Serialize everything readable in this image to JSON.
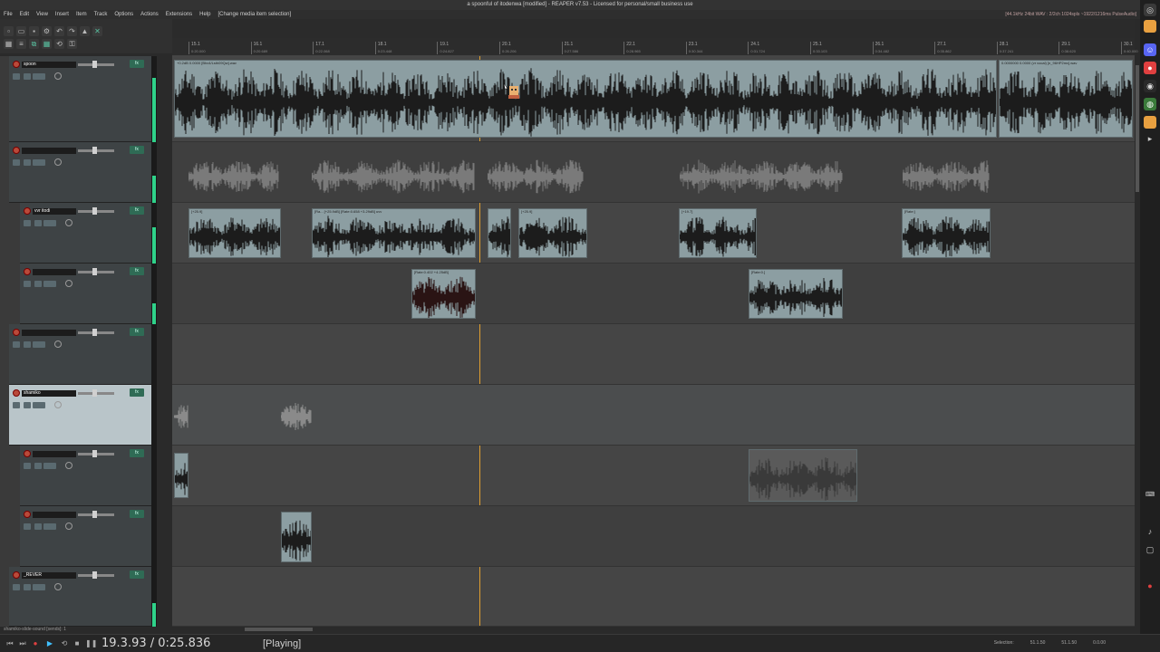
{
  "window": {
    "title": "a spoonful of itodenwa [modified] - REAPER v7.53 - Licensed for personal/small business use"
  },
  "menubar": {
    "items": [
      "File",
      "Edit",
      "View",
      "Insert",
      "Item",
      "Track",
      "Options",
      "Actions",
      "Extensions",
      "Help"
    ],
    "undo_hint": "[Change media item selection]",
    "audio_status": "[44.1kHz 24bit WAV : 2/2ch 1024spls ~1922/1216ms PulseAudio]"
  },
  "ruler": {
    "ticks": [
      {
        "bar": "15.1",
        "time": "0:20.000"
      },
      {
        "bar": "16.1",
        "time": "0:20.689"
      },
      {
        "bar": "17.1",
        "time": "0:22.068"
      },
      {
        "bar": "18.1",
        "time": "0:23.448"
      },
      {
        "bar": "19.1",
        "time": "0:24.827"
      },
      {
        "bar": "20.1",
        "time": "0:26.206"
      },
      {
        "bar": "21.1",
        "time": "0:27.586"
      },
      {
        "bar": "22.1",
        "time": "0:28.965"
      },
      {
        "bar": "23.1",
        "time": "0:30.344"
      },
      {
        "bar": "24.1",
        "time": "0:31.724"
      },
      {
        "bar": "25.1",
        "time": "0:33.103"
      },
      {
        "bar": "26.1",
        "time": "0:34.482"
      },
      {
        "bar": "27.1",
        "time": "0:35.862"
      },
      {
        "bar": "28.1",
        "time": "0:37.241"
      },
      {
        "bar": "29.1",
        "time": "0:38.620"
      },
      {
        "bar": "30.1",
        "time": "0:40.000"
      }
    ]
  },
  "tracks": [
    {
      "name": "spoon",
      "selected": false
    },
    {
      "name": "",
      "selected": false
    },
    {
      "name": "vvr itodi",
      "selected": false
    },
    {
      "name": "",
      "selected": false
    },
    {
      "name": "",
      "selected": false
    },
    {
      "name": "shamiko",
      "selected": true
    },
    {
      "name": "",
      "selected": false
    },
    {
      "name": "",
      "selected": false
    },
    {
      "name": "_REVER",
      "selected": false
    }
  ],
  "items": {
    "t0": "+0.2dB 0.0000 [Bhx4/Lsth09Qw].wav",
    "t0b": "0.0000000 0.0000 (vr vocal) [n_96HP2mx].wav",
    "t2a": "[+25.9]",
    "t2b": "[Ra... [+25.9dB] [Rate:0.658 +3.29dB] uvv",
    "t2c": "[+25.9]",
    "t2d": "[+19.7]",
    "t2e": "[Rate:]",
    "t3a": "[Rate:0.402 +4.25dB]",
    "t3b": "[Rate:0.]"
  },
  "transport": {
    "time": "19.3.93 / 0:25.836",
    "state": "[Playing]"
  },
  "status": {
    "left": "shamiko-slide-sound [sends]: 1",
    "selection_label": "Selection:",
    "sel_start": "51.1.50",
    "sel_end": "51.1.50",
    "sel_len": "0.0.00"
  },
  "colors": {
    "accent": "#2fd28a",
    "record": "#b94a3a",
    "playhead": "#e0a030",
    "item": "#8c9ea2"
  }
}
